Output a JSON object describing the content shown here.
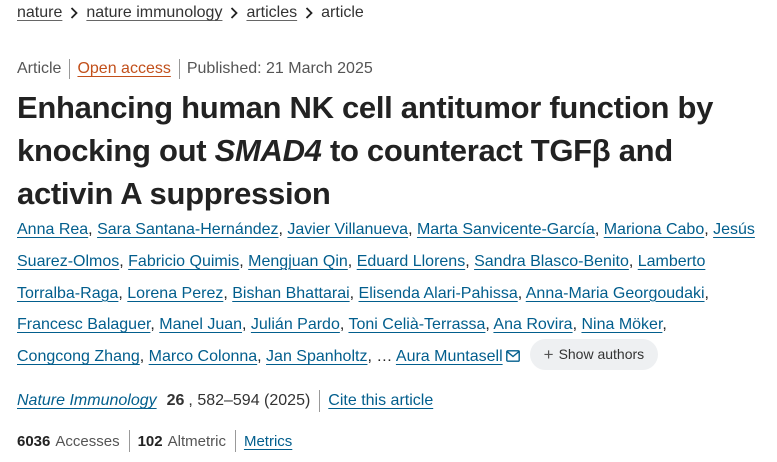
{
  "breadcrumb": {
    "items": [
      "nature",
      "nature immunology",
      "articles",
      "article"
    ]
  },
  "meta": {
    "type": "Article",
    "access": "Open access",
    "published": "Published: 21 March 2025"
  },
  "title": {
    "part1": "Enhancing human NK cell antitumor function by knocking out ",
    "gene": "SMAD4",
    "part2": " to counteract TGFβ and activin A suppression"
  },
  "authors": [
    "Anna Rea",
    "Sara Santana-Hernández",
    "Javier Villanueva",
    "Marta Sanvicente-García",
    "Mariona Cabo",
    "Jesús Suarez-Olmos",
    "Fabricio Quimis",
    "Mengjuan Qin",
    "Eduard Llorens",
    "Sandra Blasco-Benito",
    "Lamberto Torralba-Raga",
    "Lorena Perez",
    "Bishan Bhattarai",
    "Elisenda Alari-Pahissa",
    "Anna-Maria Georgoudaki",
    "Francesc Balaguer",
    "Manel Juan",
    "Julián Pardo",
    "Toni Celià-Terrassa",
    "Ana Rovira",
    "Nina Möker",
    "Congcong Zhang",
    "Marco Colonna",
    "Jan Spanholtz"
  ],
  "ellipsis": "…",
  "corresponding_author": "Aura Muntasell",
  "show_authors_label": "Show authors",
  "citation": {
    "journal": "Nature Immunology",
    "volume": "26",
    "pages": ", 582–594 (2025)",
    "cite_label": "Cite this article"
  },
  "metrics": {
    "accesses_value": "6036",
    "accesses_label": "Accesses",
    "altmetric_value": "102",
    "altmetric_label": "Altmetric",
    "metrics_label": "Metrics"
  },
  "icons": {
    "breadcrumb_separator": "chevron-right-icon",
    "email": "envelope-icon",
    "show_authors": "plus-icon"
  }
}
